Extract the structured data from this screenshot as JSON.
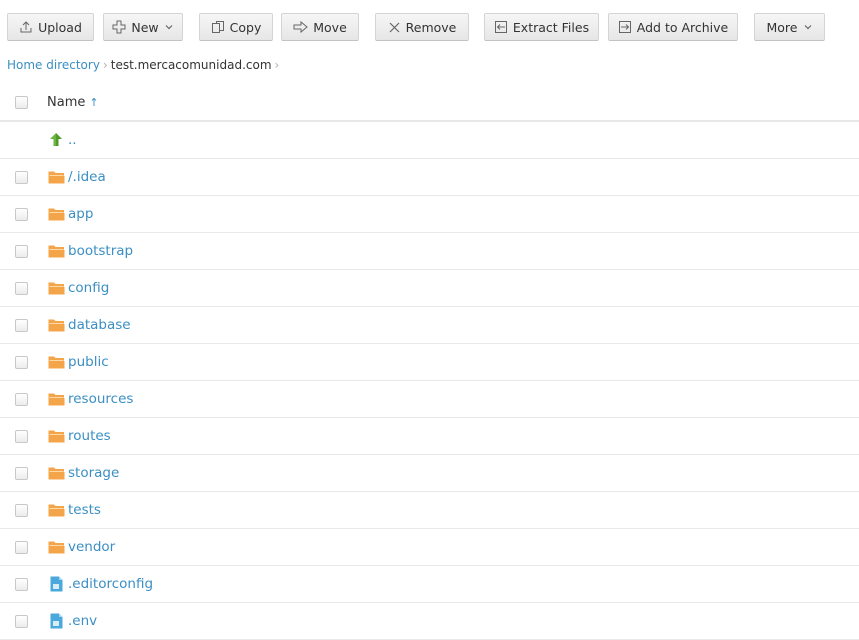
{
  "toolbar": {
    "upload": "Upload",
    "new": "New",
    "copy": "Copy",
    "move": "Move",
    "remove": "Remove",
    "extract": "Extract Files",
    "archive": "Add to Archive",
    "more": "More"
  },
  "breadcrumb": {
    "home": "Home directory",
    "current": "test.mercacomunidad.com"
  },
  "list": {
    "name_header": "Name",
    "sort_indicator": "↑",
    "parent": "..",
    "folders": [
      "/.idea",
      "app",
      "bootstrap",
      "config",
      "database",
      "public",
      "resources",
      "routes",
      "storage",
      "tests",
      "vendor"
    ],
    "files": [
      ".editorconfig",
      ".env"
    ]
  },
  "colors": {
    "link": "#3b8fc4",
    "folder": "#f4a54a",
    "file": "#4aa8dc",
    "parent_arrow": "#6cb33f"
  }
}
